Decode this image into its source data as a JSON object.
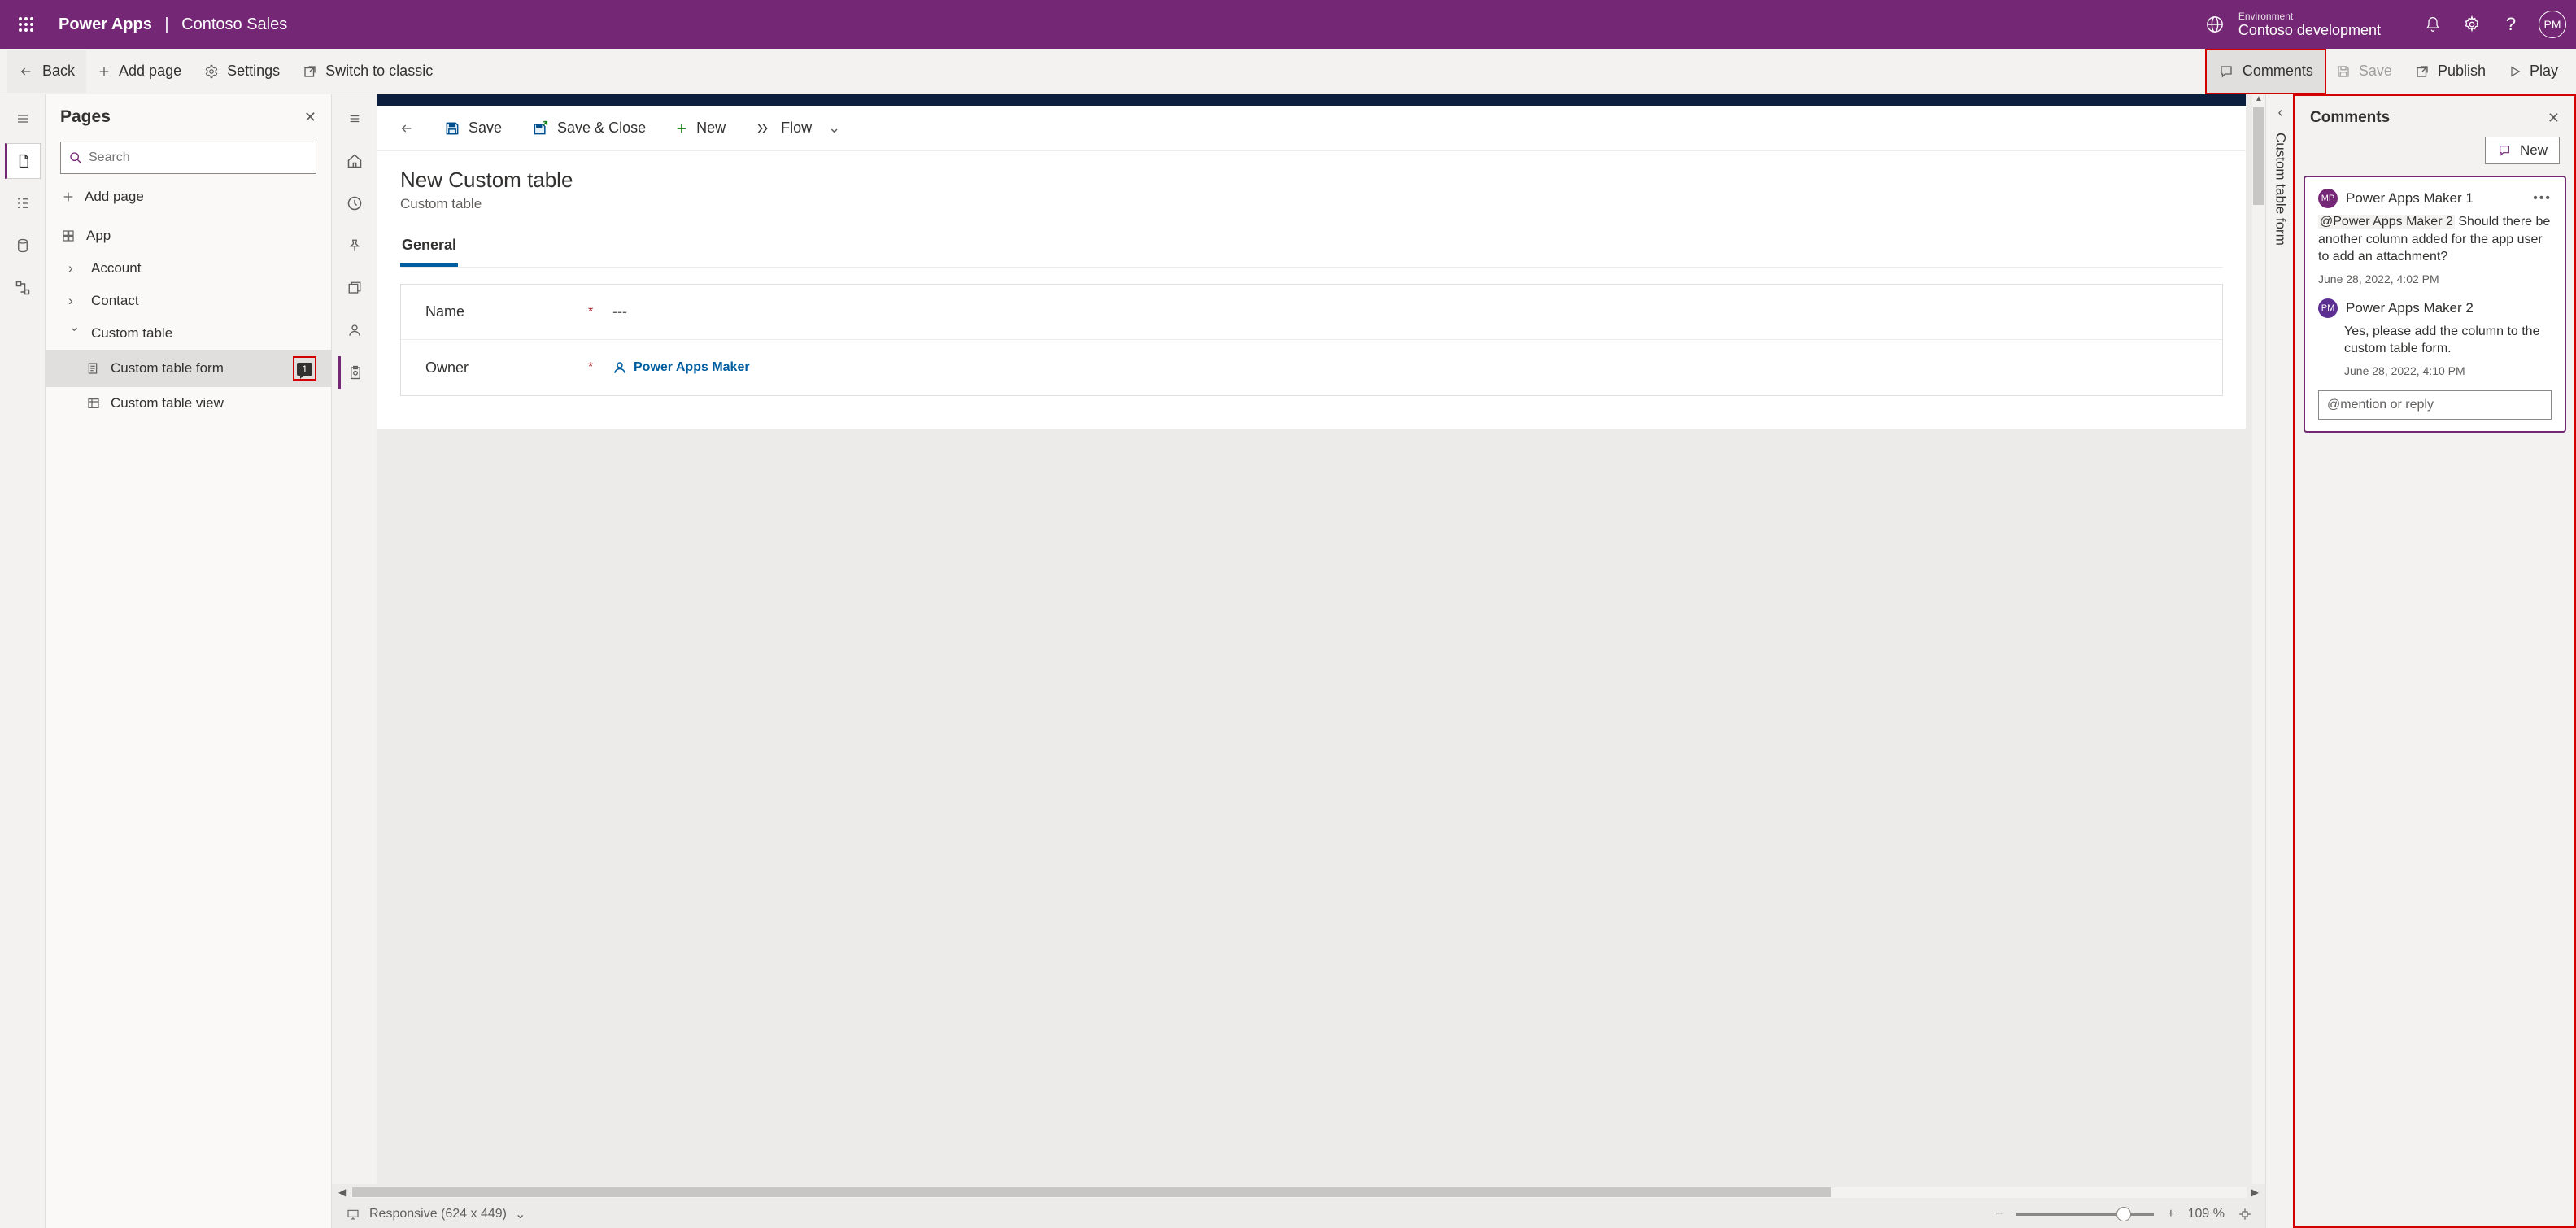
{
  "top": {
    "brand": "Power Apps",
    "app_name": "Contoso Sales",
    "env_label": "Environment",
    "env_name": "Contoso development",
    "avatar_initials": "PM"
  },
  "cmd": {
    "back": "Back",
    "add_page": "Add page",
    "settings": "Settings",
    "switch": "Switch to classic",
    "comments": "Comments",
    "save": "Save",
    "publish": "Publish",
    "play": "Play"
  },
  "pages": {
    "title": "Pages",
    "search_placeholder": "Search",
    "add_page": "Add page",
    "items": {
      "app": "App",
      "account": "Account",
      "contact": "Contact",
      "custom_table": "Custom table",
      "custom_form": "Custom table form",
      "custom_view": "Custom table view"
    },
    "badge_count": "1"
  },
  "form_toolbar": {
    "save": "Save",
    "save_close": "Save & Close",
    "new": "New",
    "flow": "Flow"
  },
  "form": {
    "title": "New Custom table",
    "subtitle": "Custom table",
    "tab": "General",
    "fields": {
      "name_label": "Name",
      "name_value": "---",
      "owner_label": "Owner",
      "owner_value": "Power Apps Maker"
    }
  },
  "prop_tab": "Custom table form",
  "comments": {
    "title": "Comments",
    "new_label": "New",
    "thread": [
      {
        "initials": "MP",
        "author": "Power Apps Maker 1",
        "mention": "@Power Apps Maker 2",
        "body_rest": " Should there be another column added for the app user to add an attachment?",
        "time": "June 28, 2022, 4:02 PM"
      },
      {
        "initials": "PM",
        "author": "Power Apps Maker 2",
        "body": "Yes, please add the column to the custom table form.",
        "time": "June 28, 2022, 4:10 PM"
      }
    ],
    "reply_placeholder": "@mention or reply"
  },
  "status": {
    "mode": "Responsive (624 x 449)",
    "zoom": "109 %"
  }
}
